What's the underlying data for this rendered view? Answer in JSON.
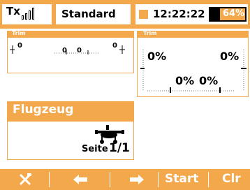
{
  "statusbar": {
    "tx_label": "Tx",
    "model_name": "Standard",
    "time": "12:22:22",
    "battery": "64%",
    "battery_level": 0.64,
    "signal_bars": 4
  },
  "trim_left": {
    "title": "Trim",
    "values": [
      "0",
      "0",
      "0",
      "0"
    ]
  },
  "trim_right": {
    "title": "Trim",
    "values": [
      "0%",
      "0%",
      "0%",
      "0%"
    ]
  },
  "model_card": {
    "title": "Flugzeug",
    "icon": "airplane-icon",
    "page_label": "Seite",
    "page_number": "1/1"
  },
  "bottombar": {
    "tools_icon": "wrench-screwdriver-icon",
    "left_icon": "arrow-left-icon",
    "right_icon": "arrow-right-icon",
    "start": "Start",
    "clear": "Clr"
  },
  "colors": {
    "accent": "#f3a84c"
  }
}
